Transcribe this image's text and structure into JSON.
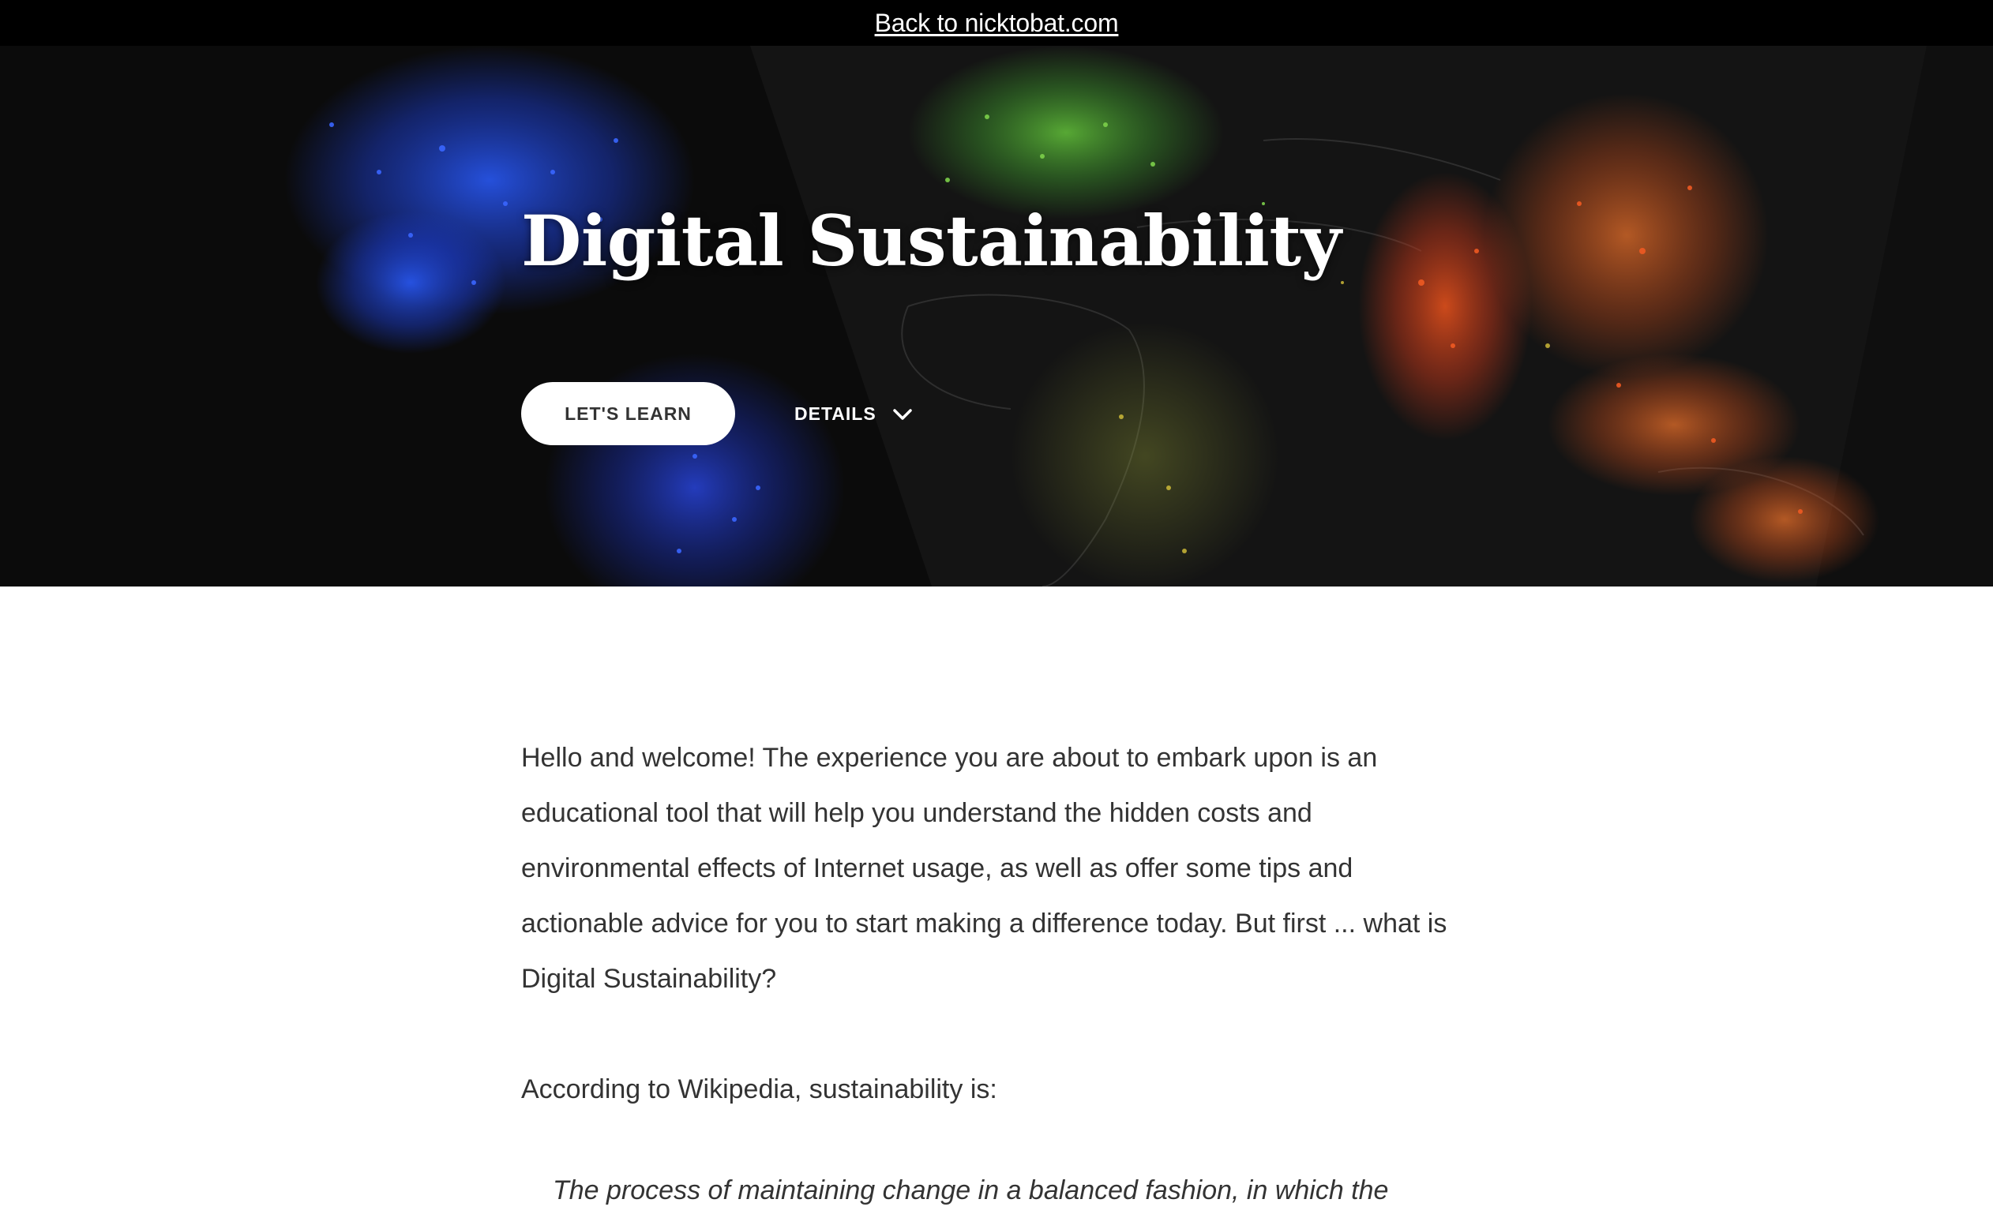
{
  "topbar": {
    "back_link": "Back to nicktobat.com"
  },
  "hero": {
    "title": "Digital Sustainability",
    "primary_button": "LET'S LEARN",
    "secondary_button": "DETAILS",
    "secondary_icon": "chevron-down-icon",
    "background": "world-map-internet-activity"
  },
  "main": {
    "intro": "Hello and welcome! The experience you are about to embark upon is an educational tool that will help you understand the hidden costs and environmental effects of Internet usage, as well as offer some tips and actionable advice for you to start making a difference today. But first ... what is Digital Sustainability?",
    "wiki_intro": "According to Wikipedia, sustainability is:",
    "quote": "The process of maintaining change in a balanced fashion, in which the"
  },
  "colors": {
    "topbar_bg": "#000000",
    "hero_bg": "#0b0b0b",
    "text": "#333333",
    "button_bg": "#ffffff"
  }
}
